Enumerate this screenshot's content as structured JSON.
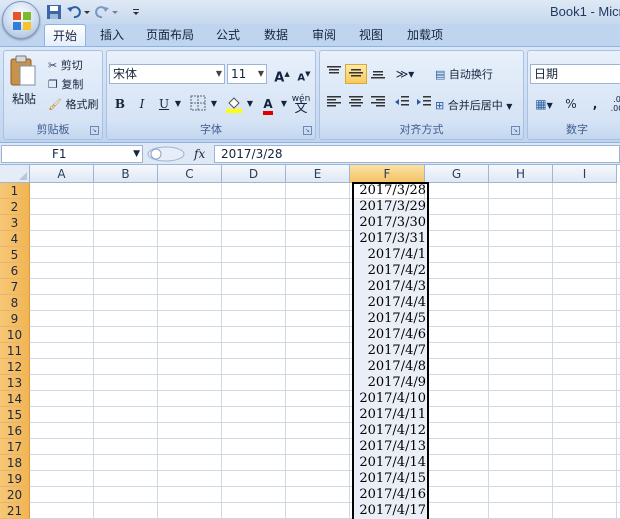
{
  "window": {
    "title": "Book1 - Micr"
  },
  "qat": {
    "save": "save-icon",
    "undo": "undo-icon",
    "redo": "redo-icon"
  },
  "tabs": [
    {
      "label": "开始",
      "active": true
    },
    {
      "label": "插入"
    },
    {
      "label": "页面布局"
    },
    {
      "label": "公式"
    },
    {
      "label": "数据"
    },
    {
      "label": "审阅"
    },
    {
      "label": "视图"
    },
    {
      "label": "加载项"
    }
  ],
  "ribbon": {
    "clipboard": {
      "label": "剪贴板",
      "paste": "粘贴",
      "cut": "剪切",
      "copy": "复制",
      "format_painter": "格式刷"
    },
    "font": {
      "label": "字体",
      "name": "宋体",
      "size": "11",
      "grow": "A",
      "shrink": "A",
      "bold": "B",
      "italic": "I",
      "underline": "U",
      "font_color_letter": "A",
      "phonetic": "wén"
    },
    "alignment": {
      "label": "对齐方式",
      "wrap_text": "自动换行",
      "merge_center": "合并后居中"
    },
    "number": {
      "label": "数字",
      "format": "日期",
      "percent": "%",
      "comma": ","
    }
  },
  "formula_bar": {
    "name_box": "F1",
    "fx": "fx",
    "value": "2017/3/28"
  },
  "sheet": {
    "columns": [
      "A",
      "B",
      "C",
      "D",
      "E",
      "F",
      "G",
      "H",
      "I"
    ],
    "selected_column": "F",
    "rows": [
      "1",
      "2",
      "3",
      "4",
      "5",
      "6",
      "7",
      "8",
      "9",
      "10",
      "11",
      "12",
      "13",
      "14",
      "15",
      "16",
      "17",
      "18",
      "19",
      "20",
      "21"
    ],
    "column_f_values": [
      "2017/3/28",
      "2017/3/29",
      "2017/3/30",
      "2017/3/31",
      "2017/4/1",
      "2017/4/2",
      "2017/4/3",
      "2017/4/4",
      "2017/4/5",
      "2017/4/6",
      "2017/4/7",
      "2017/4/8",
      "2017/4/9",
      "2017/4/10",
      "2017/4/11",
      "2017/4/12",
      "2017/4/13",
      "2017/4/14",
      "2017/4/15",
      "2017/4/16",
      "2017/4/17"
    ]
  }
}
